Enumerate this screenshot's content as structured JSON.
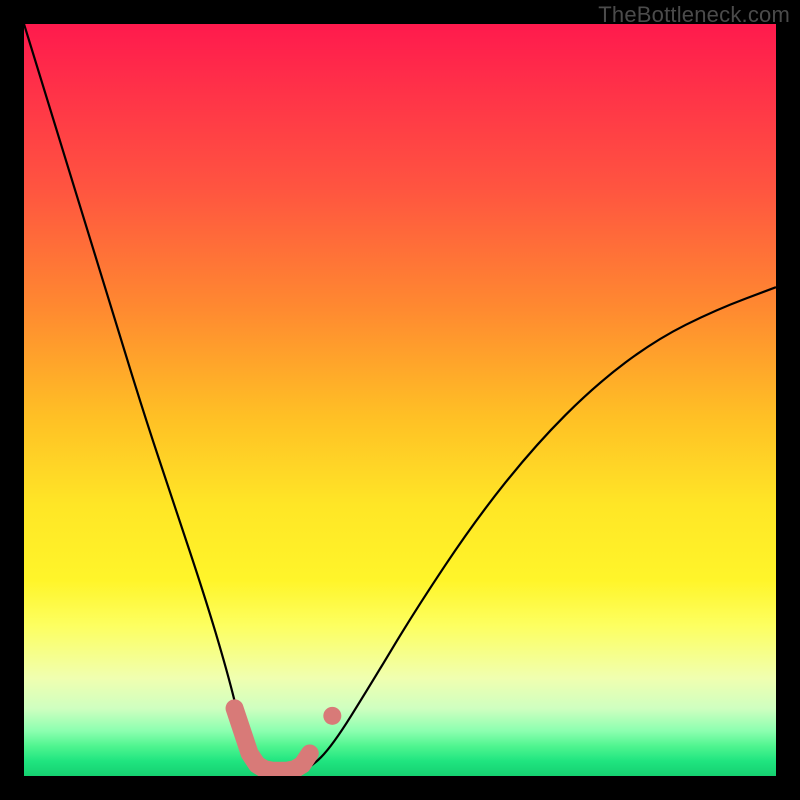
{
  "watermark": "TheBottleneck.com",
  "colors": {
    "bg": "#000000",
    "curve": "#000000",
    "marker": "#d87a78",
    "gradient_top": "#ff1a4d",
    "gradient_bottom": "#15d070"
  },
  "chart_data": {
    "type": "line",
    "title": "",
    "xlabel": "",
    "ylabel": "",
    "xlim": [
      0,
      100
    ],
    "ylim": [
      0,
      100
    ],
    "grid": false,
    "annotations": [
      "TheBottleneck.com"
    ],
    "series": [
      {
        "name": "bottleneck-curve",
        "x": [
          0,
          4,
          8,
          12,
          16,
          20,
          24,
          27,
          29,
          31,
          33,
          35,
          38,
          41,
          46,
          52,
          60,
          68,
          76,
          84,
          92,
          100
        ],
        "y": [
          100,
          87,
          74,
          61,
          48,
          36,
          24,
          14,
          6,
          2,
          0,
          0,
          1,
          4,
          12,
          22,
          34,
          44,
          52,
          58,
          62,
          65
        ]
      }
    ],
    "markers": {
      "name": "bottleneck-highlight",
      "color": "#d87a78",
      "points": [
        {
          "x": 28,
          "y": 9
        },
        {
          "x": 29,
          "y": 6
        },
        {
          "x": 30,
          "y": 3
        },
        {
          "x": 31,
          "y": 1.5
        },
        {
          "x": 32,
          "y": 0.9
        },
        {
          "x": 33,
          "y": 0.7
        },
        {
          "x": 34,
          "y": 0.7
        },
        {
          "x": 35,
          "y": 0.7
        },
        {
          "x": 36,
          "y": 0.9
        },
        {
          "x": 37,
          "y": 1.5
        },
        {
          "x": 38,
          "y": 3
        },
        {
          "x": 41,
          "y": 8
        }
      ]
    }
  }
}
